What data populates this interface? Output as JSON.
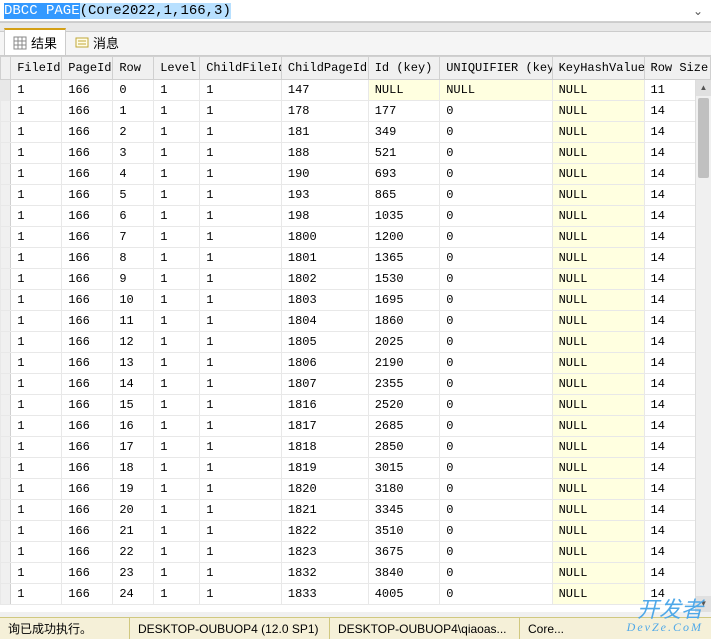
{
  "command": {
    "name": "DBCC PAGE",
    "args": "(Core2022,1,166,3)"
  },
  "tabs": {
    "results": "结果",
    "messages": "消息"
  },
  "columns": [
    "FileId",
    "PageId",
    "Row",
    "Level",
    "ChildFileId",
    "ChildPageId",
    "Id (key)",
    "UNIQUIFIER (key)",
    "KeyHashValue",
    "Row Size"
  ],
  "chart_data": {
    "type": "table",
    "columns": [
      "FileId",
      "PageId",
      "Row",
      "Level",
      "ChildFileId",
      "ChildPageId",
      "Id (key)",
      "UNIQUIFIER (key)",
      "KeyHashValue",
      "Row Size"
    ],
    "rows": [
      [
        "1",
        "166",
        "0",
        "1",
        "1",
        "147",
        "NULL",
        "NULL",
        "NULL",
        "11"
      ],
      [
        "1",
        "166",
        "1",
        "1",
        "1",
        "178",
        "177",
        "0",
        "NULL",
        "14"
      ],
      [
        "1",
        "166",
        "2",
        "1",
        "1",
        "181",
        "349",
        "0",
        "NULL",
        "14"
      ],
      [
        "1",
        "166",
        "3",
        "1",
        "1",
        "188",
        "521",
        "0",
        "NULL",
        "14"
      ],
      [
        "1",
        "166",
        "4",
        "1",
        "1",
        "190",
        "693",
        "0",
        "NULL",
        "14"
      ],
      [
        "1",
        "166",
        "5",
        "1",
        "1",
        "193",
        "865",
        "0",
        "NULL",
        "14"
      ],
      [
        "1",
        "166",
        "6",
        "1",
        "1",
        "198",
        "1035",
        "0",
        "NULL",
        "14"
      ],
      [
        "1",
        "166",
        "7",
        "1",
        "1",
        "1800",
        "1200",
        "0",
        "NULL",
        "14"
      ],
      [
        "1",
        "166",
        "8",
        "1",
        "1",
        "1801",
        "1365",
        "0",
        "NULL",
        "14"
      ],
      [
        "1",
        "166",
        "9",
        "1",
        "1",
        "1802",
        "1530",
        "0",
        "NULL",
        "14"
      ],
      [
        "1",
        "166",
        "10",
        "1",
        "1",
        "1803",
        "1695",
        "0",
        "NULL",
        "14"
      ],
      [
        "1",
        "166",
        "11",
        "1",
        "1",
        "1804",
        "1860",
        "0",
        "NULL",
        "14"
      ],
      [
        "1",
        "166",
        "12",
        "1",
        "1",
        "1805",
        "2025",
        "0",
        "NULL",
        "14"
      ],
      [
        "1",
        "166",
        "13",
        "1",
        "1",
        "1806",
        "2190",
        "0",
        "NULL",
        "14"
      ],
      [
        "1",
        "166",
        "14",
        "1",
        "1",
        "1807",
        "2355",
        "0",
        "NULL",
        "14"
      ],
      [
        "1",
        "166",
        "15",
        "1",
        "1",
        "1816",
        "2520",
        "0",
        "NULL",
        "14"
      ],
      [
        "1",
        "166",
        "16",
        "1",
        "1",
        "1817",
        "2685",
        "0",
        "NULL",
        "14"
      ],
      [
        "1",
        "166",
        "17",
        "1",
        "1",
        "1818",
        "2850",
        "0",
        "NULL",
        "14"
      ],
      [
        "1",
        "166",
        "18",
        "1",
        "1",
        "1819",
        "3015",
        "0",
        "NULL",
        "14"
      ],
      [
        "1",
        "166",
        "19",
        "1",
        "1",
        "1820",
        "3180",
        "0",
        "NULL",
        "14"
      ],
      [
        "1",
        "166",
        "20",
        "1",
        "1",
        "1821",
        "3345",
        "0",
        "NULL",
        "14"
      ],
      [
        "1",
        "166",
        "21",
        "1",
        "1",
        "1822",
        "3510",
        "0",
        "NULL",
        "14"
      ],
      [
        "1",
        "166",
        "22",
        "1",
        "1",
        "1823",
        "3675",
        "0",
        "NULL",
        "14"
      ],
      [
        "1",
        "166",
        "23",
        "1",
        "1",
        "1832",
        "3840",
        "0",
        "NULL",
        "14"
      ],
      [
        "1",
        "166",
        "24",
        "1",
        "1",
        "1833",
        "4005",
        "0",
        "NULL",
        "14"
      ]
    ]
  },
  "status": {
    "msg": "询已成功执行。",
    "server": "DESKTOP-OUBUOP4 (12.0 SP1)",
    "user": "DESKTOP-OUBUOP4\\qiaoas...",
    "db": "Core..."
  },
  "watermark": {
    "main": "开发者",
    "sub": "DevZe.CoM"
  }
}
